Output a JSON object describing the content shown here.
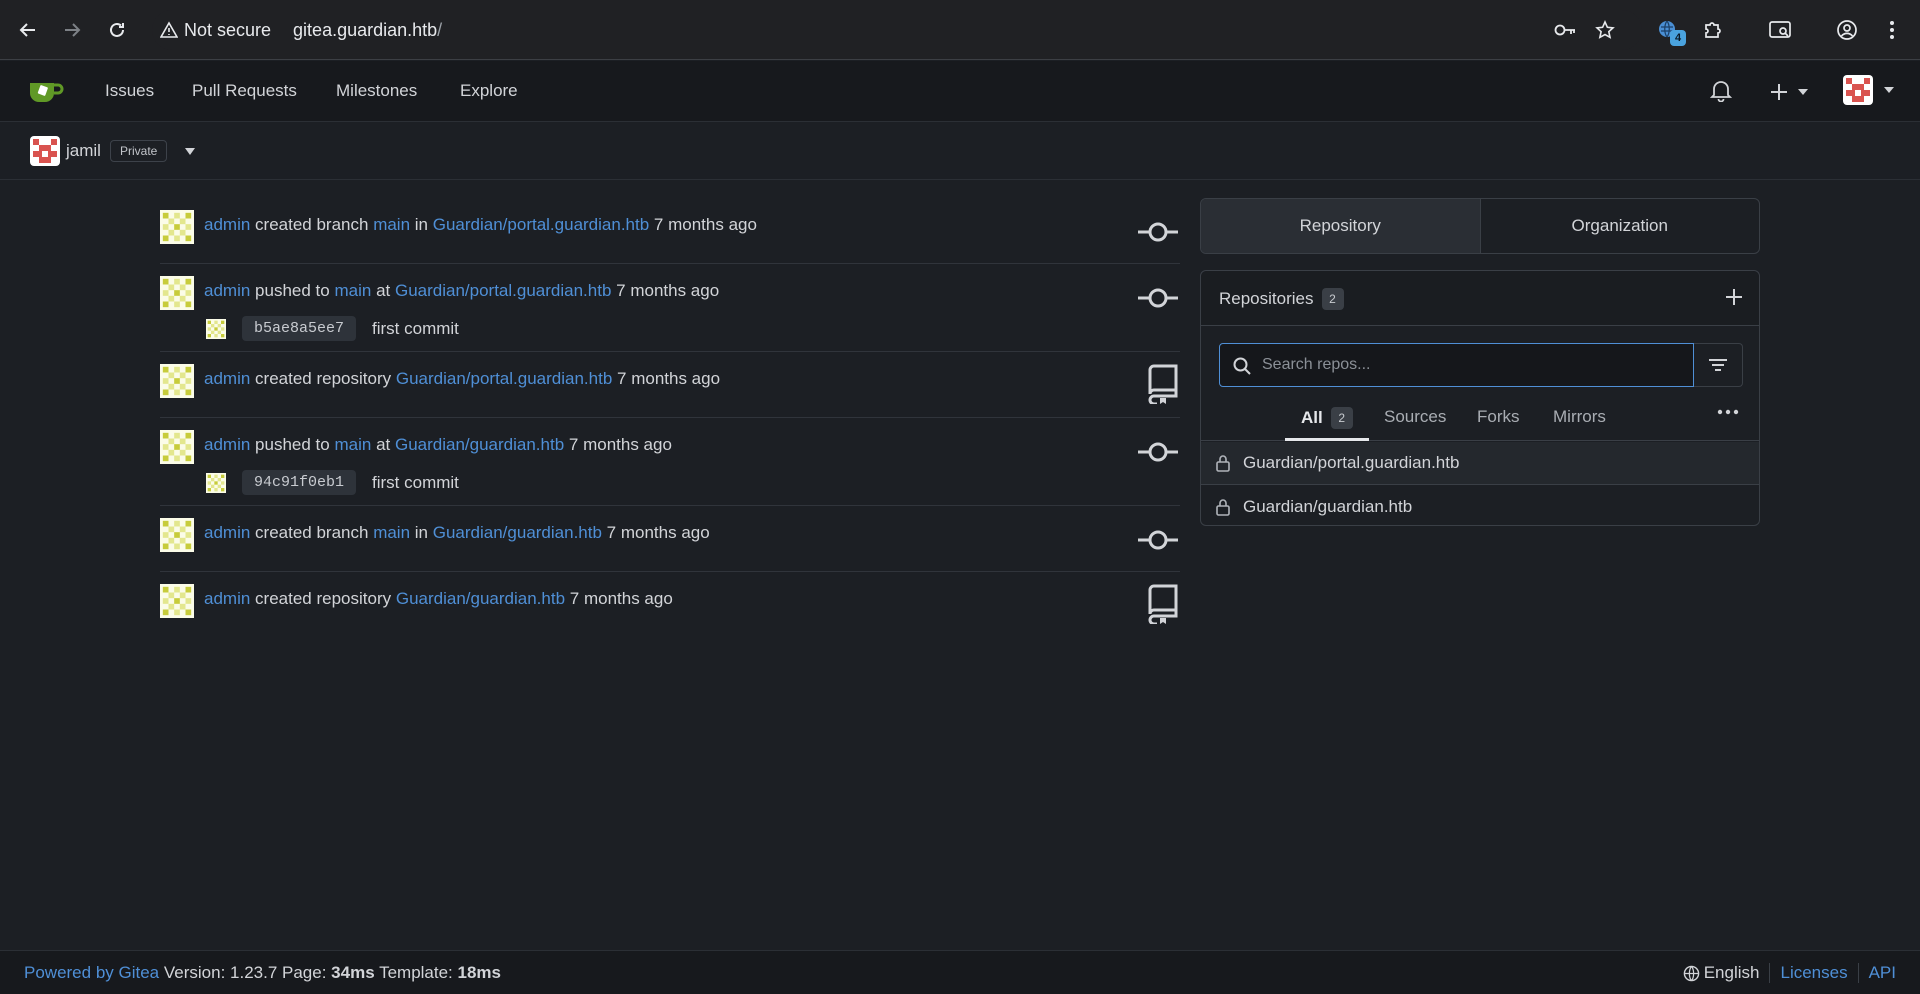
{
  "browser": {
    "security_label": "Not secure",
    "url_host": "gitea.guardian.htb",
    "url_path": "/",
    "extensions_badge": "4"
  },
  "topnav": {
    "items": [
      "Issues",
      "Pull Requests",
      "Milestones",
      "Explore"
    ]
  },
  "context": {
    "username": "jamil",
    "visibility": "Private"
  },
  "feed": [
    {
      "actor": "admin",
      "action": "created branch",
      "ref": "main",
      "prep": "in",
      "repo": "Guardian/portal.guardian.htb",
      "time": "7 months ago",
      "icon": "commit-icon"
    },
    {
      "actor": "admin",
      "action": "pushed to",
      "ref": "main",
      "prep": "at",
      "repo": "Guardian/portal.guardian.htb",
      "time": "7 months ago",
      "icon": "commit-icon",
      "commit_sha": "b5ae8a5ee7",
      "commit_msg": "first commit"
    },
    {
      "actor": "admin",
      "action": "created repository",
      "repo": "Guardian/portal.guardian.htb",
      "time": "7 months ago",
      "icon": "repo-icon"
    },
    {
      "actor": "admin",
      "action": "pushed to",
      "ref": "main",
      "prep": "at",
      "repo": "Guardian/guardian.htb",
      "time": "7 months ago",
      "icon": "commit-icon",
      "commit_sha": "94c91f0eb1",
      "commit_msg": "first commit"
    },
    {
      "actor": "admin",
      "action": "created branch",
      "ref": "main",
      "prep": "in",
      "repo": "Guardian/guardian.htb",
      "time": "7 months ago",
      "icon": "commit-icon"
    },
    {
      "actor": "admin",
      "action": "created repository",
      "repo": "Guardian/guardian.htb",
      "time": "7 months ago",
      "icon": "repo-icon"
    }
  ],
  "panel": {
    "tabs": [
      "Repository",
      "Organization"
    ],
    "repos_title": "Repositories",
    "repos_count": "2",
    "search_placeholder": "Search repos...",
    "filters": [
      "All",
      "Sources",
      "Forks",
      "Mirrors"
    ],
    "all_count": "2",
    "repos": [
      "Guardian/portal.guardian.htb",
      "Guardian/guardian.htb"
    ]
  },
  "footer": {
    "powered": "Powered by Gitea",
    "version_label": "Version: 1.23.7 Page:",
    "page_time": "34ms",
    "template_label": "Template:",
    "template_time": "18ms",
    "language": "English",
    "licenses": "Licenses",
    "api": "API"
  }
}
